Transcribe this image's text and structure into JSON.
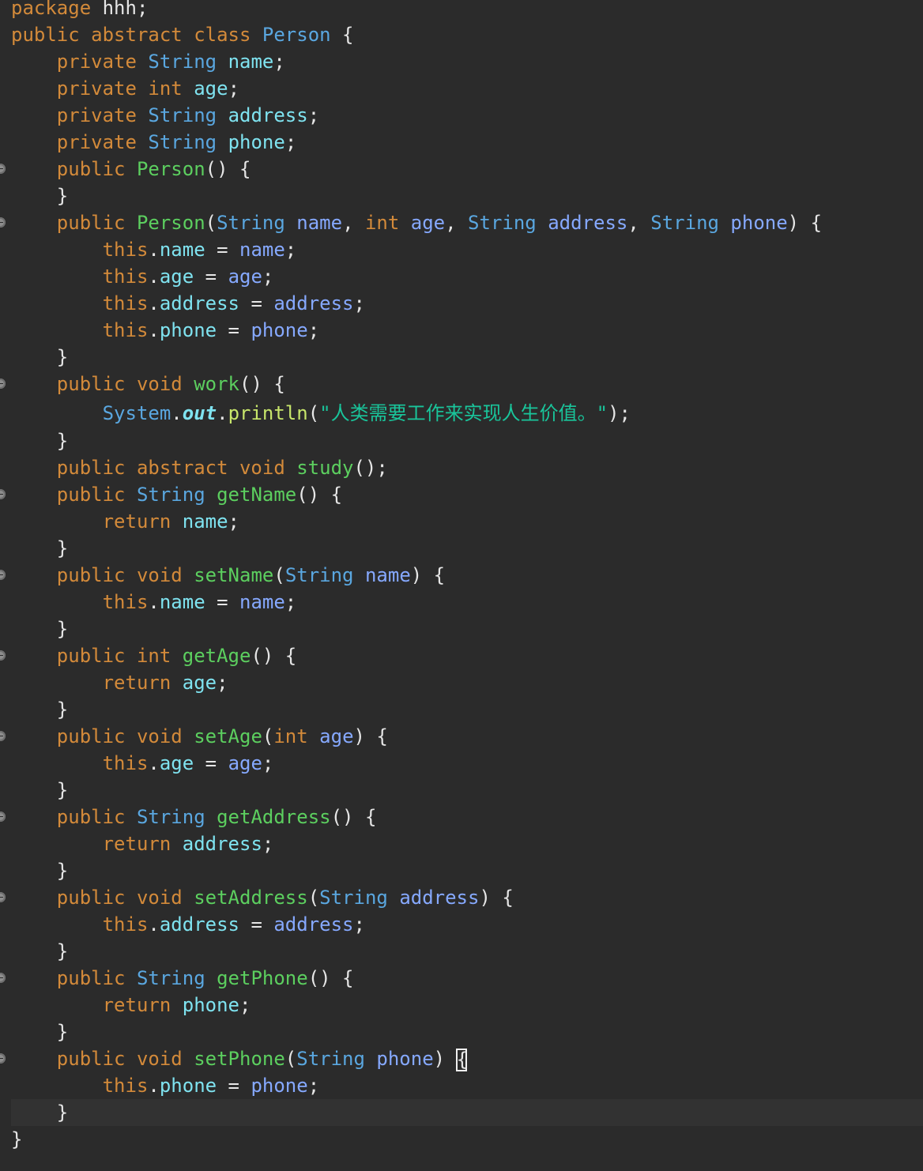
{
  "editor": {
    "language": "java",
    "theme_colors": {
      "background": "#2b2b2b",
      "current_line": "#323232",
      "keyword": "#d38a3a",
      "type": "#5aa7e0",
      "field": "#7fe3f0",
      "parameter": "#86a9ff",
      "declaration": "#5ccf5f",
      "method_call": "#c8e66b",
      "string": "#19c59b",
      "text": "#e6e6e6"
    },
    "fold_icon": "fold-collapse-icon",
    "lines": [
      {
        "tokens": [
          [
            "kw",
            "package"
          ],
          [
            "plain",
            " hhh;"
          ]
        ]
      },
      {
        "tokens": [
          [
            "kw",
            "public abstract class"
          ],
          [
            "plain",
            " "
          ],
          [
            "cls",
            "Person"
          ],
          [
            "plain",
            " {"
          ]
        ]
      },
      {
        "tokens": [
          [
            "plain",
            "    "
          ],
          [
            "kw",
            "private"
          ],
          [
            "plain",
            " "
          ],
          [
            "type",
            "String"
          ],
          [
            "plain",
            " "
          ],
          [
            "field",
            "name"
          ],
          [
            "plain",
            ";"
          ]
        ]
      },
      {
        "tokens": [
          [
            "plain",
            "    "
          ],
          [
            "kw",
            "private int"
          ],
          [
            "plain",
            " "
          ],
          [
            "field",
            "age"
          ],
          [
            "plain",
            ";"
          ]
        ]
      },
      {
        "tokens": [
          [
            "plain",
            "    "
          ],
          [
            "kw",
            "private"
          ],
          [
            "plain",
            " "
          ],
          [
            "type",
            "String"
          ],
          [
            "plain",
            " "
          ],
          [
            "field",
            "address"
          ],
          [
            "plain",
            ";"
          ]
        ]
      },
      {
        "tokens": [
          [
            "plain",
            "    "
          ],
          [
            "kw",
            "private"
          ],
          [
            "plain",
            " "
          ],
          [
            "type",
            "String"
          ],
          [
            "plain",
            " "
          ],
          [
            "field",
            "phone"
          ],
          [
            "plain",
            ";"
          ]
        ]
      },
      {
        "fold": true,
        "tokens": [
          [
            "plain",
            "    "
          ],
          [
            "kw",
            "public"
          ],
          [
            "plain",
            " "
          ],
          [
            "decl",
            "Person"
          ],
          [
            "plain",
            "() {"
          ]
        ]
      },
      {
        "tokens": [
          [
            "plain",
            "    }"
          ]
        ]
      },
      {
        "fold": true,
        "tokens": [
          [
            "plain",
            "    "
          ],
          [
            "kw",
            "public"
          ],
          [
            "plain",
            " "
          ],
          [
            "decl",
            "Person"
          ],
          [
            "plain",
            "("
          ],
          [
            "type",
            "String"
          ],
          [
            "plain",
            " "
          ],
          [
            "param",
            "name"
          ],
          [
            "plain",
            ", "
          ],
          [
            "kw",
            "int"
          ],
          [
            "plain",
            " "
          ],
          [
            "param",
            "age"
          ],
          [
            "plain",
            ", "
          ],
          [
            "type",
            "String"
          ],
          [
            "plain",
            " "
          ],
          [
            "param",
            "address"
          ],
          [
            "plain",
            ", "
          ],
          [
            "type",
            "String"
          ],
          [
            "plain",
            " "
          ],
          [
            "param",
            "phone"
          ],
          [
            "plain",
            ") {"
          ]
        ]
      },
      {
        "tokens": [
          [
            "plain",
            "        "
          ],
          [
            "kw",
            "this"
          ],
          [
            "plain",
            "."
          ],
          [
            "field",
            "name"
          ],
          [
            "plain",
            " = "
          ],
          [
            "param",
            "name"
          ],
          [
            "plain",
            ";"
          ]
        ]
      },
      {
        "tokens": [
          [
            "plain",
            "        "
          ],
          [
            "kw",
            "this"
          ],
          [
            "plain",
            "."
          ],
          [
            "field",
            "age"
          ],
          [
            "plain",
            " = "
          ],
          [
            "param",
            "age"
          ],
          [
            "plain",
            ";"
          ]
        ]
      },
      {
        "tokens": [
          [
            "plain",
            "        "
          ],
          [
            "kw",
            "this"
          ],
          [
            "plain",
            "."
          ],
          [
            "field",
            "address"
          ],
          [
            "plain",
            " = "
          ],
          [
            "param",
            "address"
          ],
          [
            "plain",
            ";"
          ]
        ]
      },
      {
        "tokens": [
          [
            "plain",
            "        "
          ],
          [
            "kw",
            "this"
          ],
          [
            "plain",
            "."
          ],
          [
            "field",
            "phone"
          ],
          [
            "plain",
            " = "
          ],
          [
            "param",
            "phone"
          ],
          [
            "plain",
            ";"
          ]
        ]
      },
      {
        "tokens": [
          [
            "plain",
            "    }"
          ]
        ]
      },
      {
        "fold": true,
        "tokens": [
          [
            "plain",
            "    "
          ],
          [
            "kw",
            "public void"
          ],
          [
            "plain",
            " "
          ],
          [
            "decl",
            "work"
          ],
          [
            "plain",
            "() {"
          ]
        ]
      },
      {
        "tall": true,
        "tokens": [
          [
            "plain",
            "        "
          ],
          [
            "type",
            "System"
          ],
          [
            "plain",
            "."
          ],
          [
            "static-field",
            "out"
          ],
          [
            "plain",
            "."
          ],
          [
            "call",
            "println"
          ],
          [
            "plain",
            "("
          ],
          [
            "string",
            "\"人类需要工作来实现人生价值。\""
          ],
          [
            "plain",
            ");"
          ]
        ]
      },
      {
        "tokens": [
          [
            "plain",
            "    }"
          ]
        ]
      },
      {
        "tokens": [
          [
            "plain",
            "    "
          ],
          [
            "kw",
            "public abstract void"
          ],
          [
            "plain",
            " "
          ],
          [
            "decl",
            "study"
          ],
          [
            "plain",
            "();"
          ]
        ]
      },
      {
        "fold": true,
        "tokens": [
          [
            "plain",
            "    "
          ],
          [
            "kw",
            "public"
          ],
          [
            "plain",
            " "
          ],
          [
            "type",
            "String"
          ],
          [
            "plain",
            " "
          ],
          [
            "decl",
            "getName"
          ],
          [
            "plain",
            "() {"
          ]
        ]
      },
      {
        "tokens": [
          [
            "plain",
            "        "
          ],
          [
            "kw",
            "return"
          ],
          [
            "plain",
            " "
          ],
          [
            "field",
            "name"
          ],
          [
            "plain",
            ";"
          ]
        ]
      },
      {
        "tokens": [
          [
            "plain",
            "    }"
          ]
        ]
      },
      {
        "fold": true,
        "tokens": [
          [
            "plain",
            "    "
          ],
          [
            "kw",
            "public void"
          ],
          [
            "plain",
            " "
          ],
          [
            "decl",
            "setName"
          ],
          [
            "plain",
            "("
          ],
          [
            "type",
            "String"
          ],
          [
            "plain",
            " "
          ],
          [
            "param",
            "name"
          ],
          [
            "plain",
            ") {"
          ]
        ]
      },
      {
        "tokens": [
          [
            "plain",
            "        "
          ],
          [
            "kw",
            "this"
          ],
          [
            "plain",
            "."
          ],
          [
            "field",
            "name"
          ],
          [
            "plain",
            " = "
          ],
          [
            "param",
            "name"
          ],
          [
            "plain",
            ";"
          ]
        ]
      },
      {
        "tokens": [
          [
            "plain",
            "    }"
          ]
        ]
      },
      {
        "fold": true,
        "tokens": [
          [
            "plain",
            "    "
          ],
          [
            "kw",
            "public int"
          ],
          [
            "plain",
            " "
          ],
          [
            "decl",
            "getAge"
          ],
          [
            "plain",
            "() {"
          ]
        ]
      },
      {
        "tokens": [
          [
            "plain",
            "        "
          ],
          [
            "kw",
            "return"
          ],
          [
            "plain",
            " "
          ],
          [
            "field",
            "age"
          ],
          [
            "plain",
            ";"
          ]
        ]
      },
      {
        "tokens": [
          [
            "plain",
            "    }"
          ]
        ]
      },
      {
        "fold": true,
        "tokens": [
          [
            "plain",
            "    "
          ],
          [
            "kw",
            "public void"
          ],
          [
            "plain",
            " "
          ],
          [
            "decl",
            "setAge"
          ],
          [
            "plain",
            "("
          ],
          [
            "kw",
            "int"
          ],
          [
            "plain",
            " "
          ],
          [
            "param",
            "age"
          ],
          [
            "plain",
            ") {"
          ]
        ]
      },
      {
        "tokens": [
          [
            "plain",
            "        "
          ],
          [
            "kw",
            "this"
          ],
          [
            "plain",
            "."
          ],
          [
            "field",
            "age"
          ],
          [
            "plain",
            " = "
          ],
          [
            "param",
            "age"
          ],
          [
            "plain",
            ";"
          ]
        ]
      },
      {
        "tokens": [
          [
            "plain",
            "    }"
          ]
        ]
      },
      {
        "fold": true,
        "tokens": [
          [
            "plain",
            "    "
          ],
          [
            "kw",
            "public"
          ],
          [
            "plain",
            " "
          ],
          [
            "type",
            "String"
          ],
          [
            "plain",
            " "
          ],
          [
            "decl",
            "getAddress"
          ],
          [
            "plain",
            "() {"
          ]
        ]
      },
      {
        "tokens": [
          [
            "plain",
            "        "
          ],
          [
            "kw",
            "return"
          ],
          [
            "plain",
            " "
          ],
          [
            "field",
            "address"
          ],
          [
            "plain",
            ";"
          ]
        ]
      },
      {
        "tokens": [
          [
            "plain",
            "    }"
          ]
        ]
      },
      {
        "fold": true,
        "tokens": [
          [
            "plain",
            "    "
          ],
          [
            "kw",
            "public void"
          ],
          [
            "plain",
            " "
          ],
          [
            "decl",
            "setAddress"
          ],
          [
            "plain",
            "("
          ],
          [
            "type",
            "String"
          ],
          [
            "plain",
            " "
          ],
          [
            "param",
            "address"
          ],
          [
            "plain",
            ") {"
          ]
        ]
      },
      {
        "tokens": [
          [
            "plain",
            "        "
          ],
          [
            "kw",
            "this"
          ],
          [
            "plain",
            "."
          ],
          [
            "field",
            "address"
          ],
          [
            "plain",
            " = "
          ],
          [
            "param",
            "address"
          ],
          [
            "plain",
            ";"
          ]
        ]
      },
      {
        "tokens": [
          [
            "plain",
            "    }"
          ]
        ]
      },
      {
        "fold": true,
        "tokens": [
          [
            "plain",
            "    "
          ],
          [
            "kw",
            "public"
          ],
          [
            "plain",
            " "
          ],
          [
            "type",
            "String"
          ],
          [
            "plain",
            " "
          ],
          [
            "decl",
            "getPhone"
          ],
          [
            "plain",
            "() {"
          ]
        ]
      },
      {
        "tokens": [
          [
            "plain",
            "        "
          ],
          [
            "kw",
            "return"
          ],
          [
            "plain",
            " "
          ],
          [
            "field",
            "phone"
          ],
          [
            "plain",
            ";"
          ]
        ]
      },
      {
        "tokens": [
          [
            "plain",
            "    }"
          ]
        ]
      },
      {
        "fold": true,
        "tokens": [
          [
            "plain",
            "    "
          ],
          [
            "kw",
            "public void"
          ],
          [
            "plain",
            " "
          ],
          [
            "decl",
            "setPhone"
          ],
          [
            "plain",
            "("
          ],
          [
            "type",
            "String"
          ],
          [
            "plain",
            " "
          ],
          [
            "param",
            "phone"
          ],
          [
            "plain",
            ") "
          ],
          [
            "bracket",
            "{"
          ]
        ]
      },
      {
        "tokens": [
          [
            "plain",
            "        "
          ],
          [
            "kw",
            "this"
          ],
          [
            "plain",
            "."
          ],
          [
            "field",
            "phone"
          ],
          [
            "plain",
            " = "
          ],
          [
            "param",
            "phone"
          ],
          [
            "plain",
            ";"
          ]
        ]
      },
      {
        "current": true,
        "tokens": [
          [
            "plain",
            "    }"
          ]
        ]
      },
      {
        "tokens": [
          [
            "plain",
            "}"
          ]
        ]
      }
    ]
  }
}
